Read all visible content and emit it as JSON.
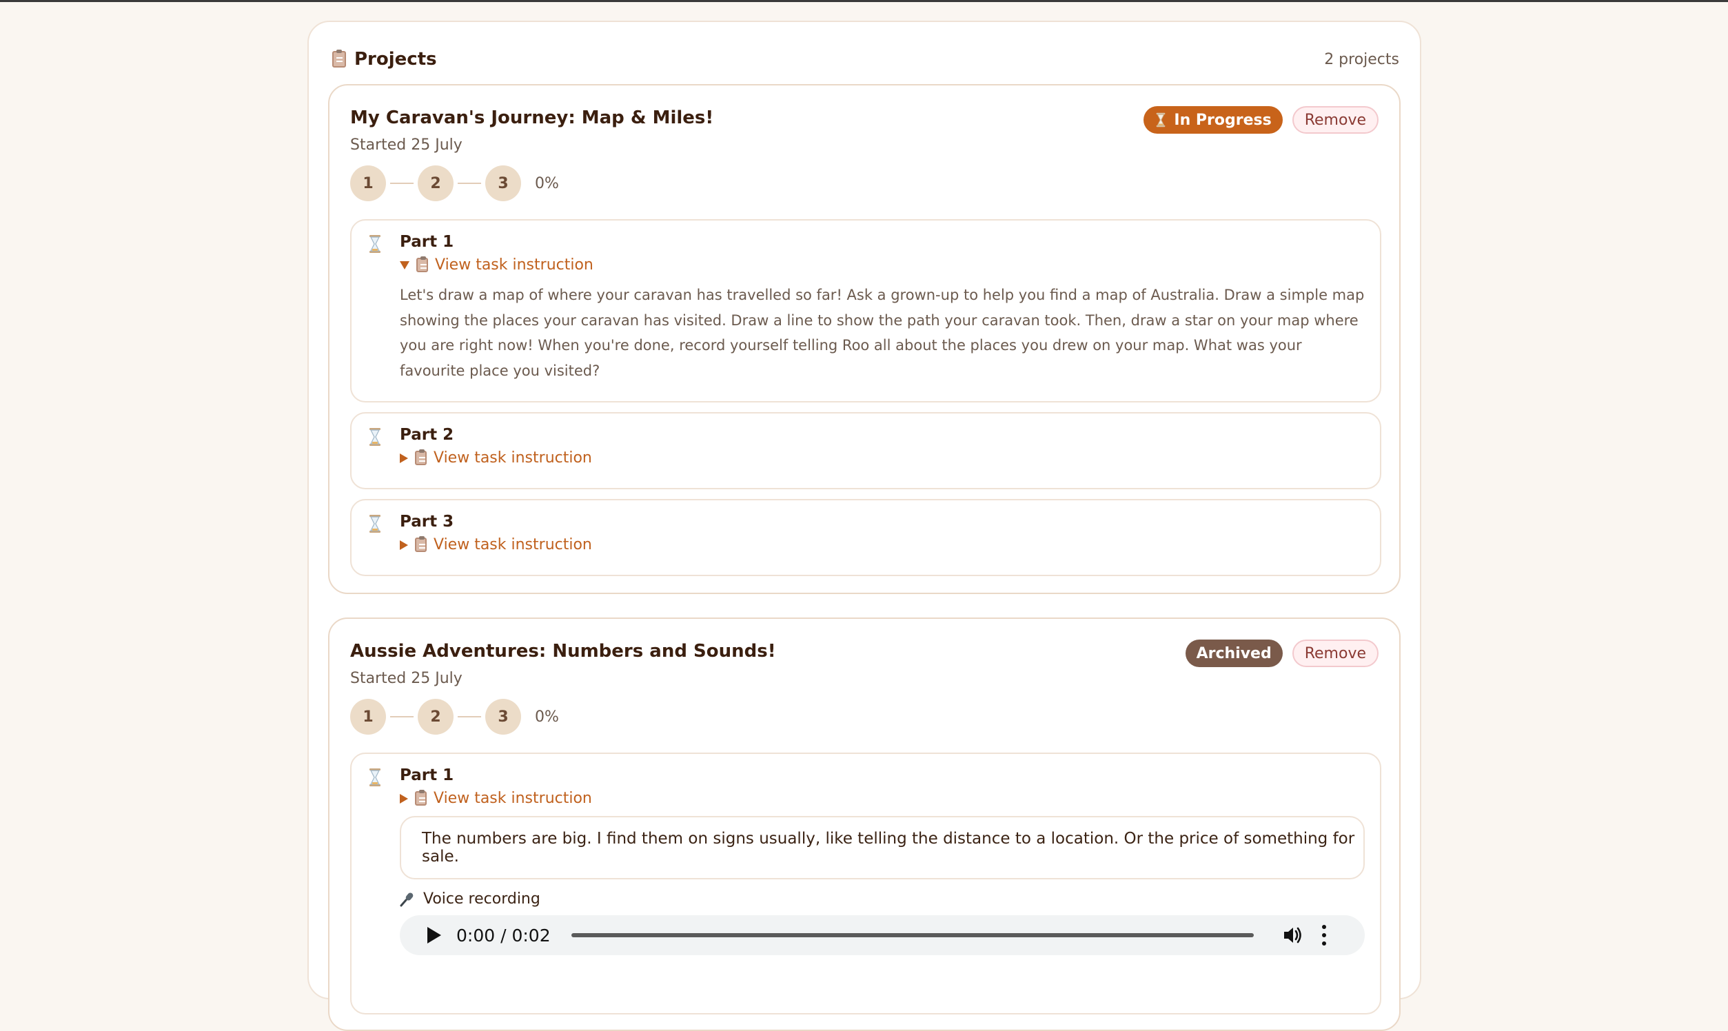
{
  "panel": {
    "title": "Projects",
    "count": "2 projects"
  },
  "projects": [
    {
      "title": "My Caravan's Journey: Map & Miles!",
      "started": "Started 25 July",
      "status": "In Progress",
      "status_color": "#c8631a",
      "remove_label": "Remove",
      "steps": [
        "1",
        "2",
        "3"
      ],
      "progress": "0%",
      "tasks": [
        {
          "name": "Part 1",
          "instruction_label": "View task instruction",
          "expanded": true,
          "instruction": "Let's draw a map of where your caravan has travelled so far! Ask a grown-up to help you find a map of Australia. Draw a simple map showing the places your caravan has visited. Draw a line to show the path your caravan took. Then, draw a star on your map where you are right now! When you're done, record yourself telling Roo all about the places you drew on your map. What was your favourite place you visited?"
        },
        {
          "name": "Part 2",
          "instruction_label": "View task instruction",
          "expanded": false
        },
        {
          "name": "Part 3",
          "instruction_label": "View task instruction",
          "expanded": false
        }
      ]
    },
    {
      "title": "Aussie Adventures: Numbers and Sounds!",
      "started": "Started 25 July",
      "status": "Archived",
      "status_color": "#7a5a4a",
      "remove_label": "Remove",
      "steps": [
        "1",
        "2",
        "3"
      ],
      "progress": "0%",
      "tasks": [
        {
          "name": "Part 1",
          "instruction_label": "View task instruction",
          "expanded": false,
          "answer": "The numbers are big. I find them on signs usually, like telling the distance to a location. Or the price of something for sale.",
          "voice_label": "Voice recording",
          "audio_time": "0:00 / 0:02"
        }
      ]
    }
  ],
  "icons": {
    "panel": "clipboard-icon",
    "task_status": "hourglass-icon",
    "instruction": "clipboard-icon",
    "voice": "microphone-icon",
    "audio": [
      "play-icon",
      "volume-icon",
      "more-options-icon"
    ]
  }
}
